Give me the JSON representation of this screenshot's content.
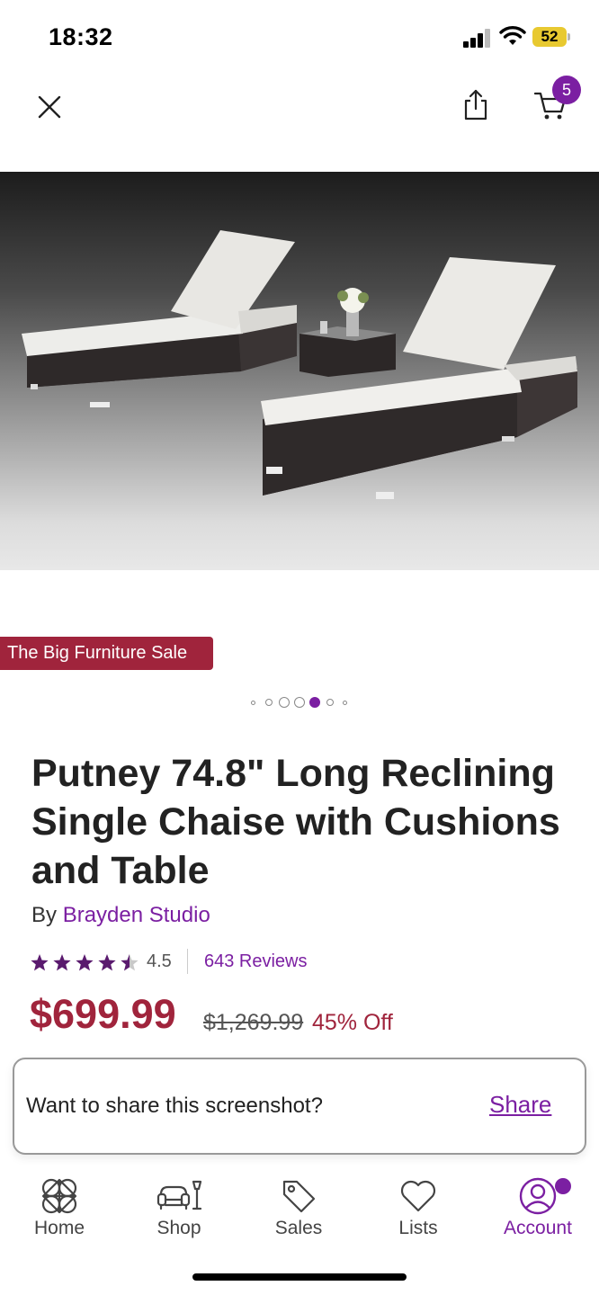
{
  "status": {
    "time": "18:32",
    "battery": "52"
  },
  "nav": {
    "cart_count": "5"
  },
  "product": {
    "sale_badge": "The Big Furniture Sale",
    "title": "Putney 74.8\" Long Reclining Single Chaise with Cushions and Table",
    "by_prefix": "By",
    "brand": "Brayden Studio",
    "rating": "4.5",
    "rating_value": 4.5,
    "reviews": "643 Reviews",
    "price": "$699.99",
    "original_price": "$1,269.99",
    "discount": "45% Off",
    "image_count": 7,
    "active_image_index": 4
  },
  "toast": {
    "message": "Want to share this screenshot?",
    "action": "Share"
  },
  "bottom_nav": [
    {
      "label": "Home",
      "icon": "home-icon"
    },
    {
      "label": "Shop",
      "icon": "shop-icon"
    },
    {
      "label": "Sales",
      "icon": "tag-icon"
    },
    {
      "label": "Lists",
      "icon": "heart-icon"
    },
    {
      "label": "Account",
      "icon": "account-icon",
      "active": true
    }
  ],
  "colors": {
    "accent": "#7b1fa2",
    "sale": "#a0243c"
  }
}
